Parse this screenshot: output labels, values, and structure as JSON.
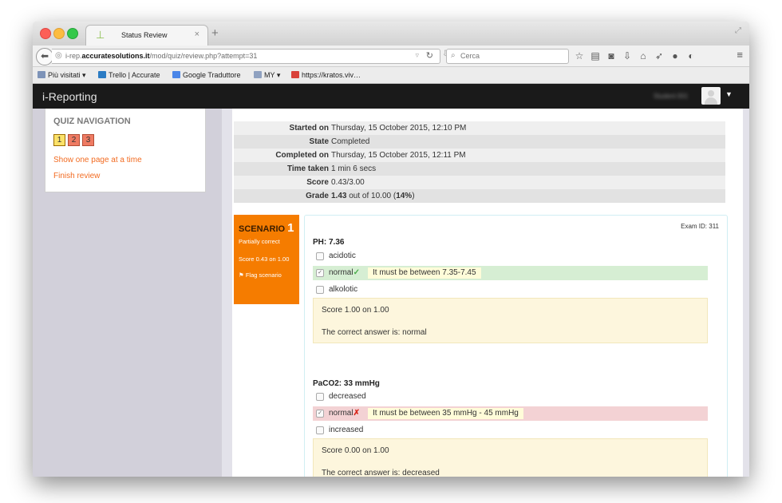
{
  "browser": {
    "tab_title": "Status Review",
    "tab_close": "×",
    "new_tab": "+",
    "url_prefix": "i-rep.",
    "url_domain": "accuratesolutions.it",
    "url_path": "/mod/quiz/review.php?attempt=31",
    "search_placeholder": "Cerca",
    "bookmarks": [
      "Più visitati ▾",
      "Trello | Accurate",
      "Google Traduttore",
      "MY ▾",
      "https://kratos.viv…"
    ]
  },
  "app": {
    "brand": "i-Reporting",
    "user_name": "Student 001"
  },
  "quiz_navigation": {
    "title": "QUIZ NAVIGATION",
    "questions": [
      "1",
      "2",
      "3"
    ],
    "show_one_page": "Show one page at a time",
    "finish_review": "Finish review"
  },
  "summary": {
    "rows": [
      {
        "label": "Started on",
        "value": "Thursday, 15 October 2015, 12:10 PM"
      },
      {
        "label": "State",
        "value": "Completed"
      },
      {
        "label": "Completed on",
        "value": "Thursday, 15 October 2015, 12:11 PM"
      },
      {
        "label": "Time taken",
        "value": "1 min 6 secs"
      },
      {
        "label": "Score",
        "value": "0.43/3.00"
      }
    ],
    "grade_label": "Grade",
    "grade_bold": "1.43",
    "grade_mid": " out of 10.00 (",
    "grade_percent": "14%",
    "grade_end": ")"
  },
  "scenario": {
    "title": "SCENARIO",
    "number": "1",
    "status": "Partially correct",
    "score": "Score 0.43 on 1.00",
    "flag": "Flag scenario"
  },
  "exam_id": "Exam ID: 311",
  "questions": [
    {
      "title": "PH: 7.36",
      "options": [
        "acidotic",
        "normal",
        "alkolotic"
      ],
      "feedback": "It must be between 7.35-7.45",
      "score": "Score 1.00 on 1.00",
      "correct_answer": "The correct answer is: normal"
    },
    {
      "title": "PaCO2: 33 mmHg",
      "options": [
        "decreased",
        "normal",
        "increased"
      ],
      "feedback": "It must be between 35 mmHg - 45 mmHg",
      "score": "Score 0.00 on 1.00",
      "correct_answer": "The correct answer is: decreased"
    }
  ],
  "colors": {
    "accent": "#f57c00",
    "link": "#f26b21",
    "correct_bg": "#d6eed3",
    "wrong_bg": "#f3d2d4",
    "appbar": "#1a1a1a"
  }
}
